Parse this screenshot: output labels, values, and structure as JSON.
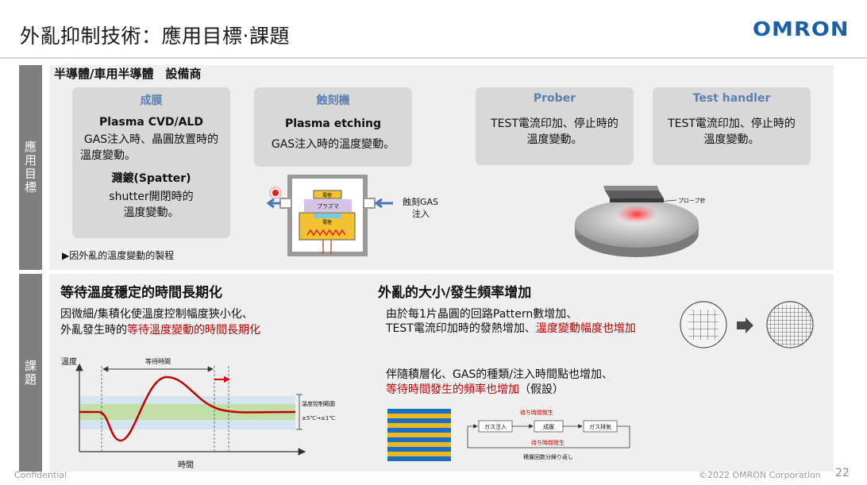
{
  "header": {
    "title": "外亂抑制技術：應用目標‧課題",
    "logo_text": "OMRON"
  },
  "tabs": {
    "application": "應用目標",
    "issue": "課題"
  },
  "application": {
    "heading": "半導體/車用半導體　設備商",
    "boxes": {
      "deposition": {
        "title": "成膜",
        "sub1": "Plasma CVD/ALD",
        "line1": "GAS注入時、晶圓放置時的",
        "line2": "溫度變動。",
        "sub2": "濺鍍(Spatter)",
        "line3": "shutter開閉時的",
        "line4": "溫度變動。"
      },
      "etching": {
        "title": "蝕刻機",
        "sub1": "Plasma etching",
        "line1": "GAS注入時的溫度變動。"
      },
      "prober": {
        "title": "Prober",
        "line1": "TEST電流印加、停止時的",
        "line2": "溫度變動。"
      },
      "handler": {
        "title": "Test handler",
        "line1": "TEST電流印加、停止時的",
        "line2": "溫度變動。"
      }
    },
    "chamber_labels": {
      "top": "電極",
      "plasma": "プラズマ",
      "bottom": "電極",
      "gas": "蝕刻GAS",
      "inject": "注入"
    },
    "probe_label": "プローブ針",
    "note": "▶因外亂的溫度變動的製程"
  },
  "issue": {
    "left_title": "等待溫度穩定的時間長期化",
    "left_line1": "因微細/集積化使溫度控制幅度狹小化、",
    "left_line2_a": "外亂發生時的",
    "left_line2_b": "等待溫度變動的時間長期化",
    "chart_labels": {
      "y": "溫度",
      "x": "時間",
      "wait": "等待時間",
      "range1": "溫度控制範圍",
      "range2": "±5℃→±1℃"
    },
    "right_title": "外亂的大小/發生頻率增加",
    "right_line1": "由於每1片晶圓的回路Pattern數增加、",
    "right_line2_a": "TEST電流印加時的發熱增加、",
    "right_line2_b": "溫度變動幅度也增加",
    "right_line3": "伴隨積層化、GAS的種類/注入時間點也增加、",
    "right_line4_a": "等待時間發生的頻率也增加",
    "right_line4_b": "（假設）",
    "flow": {
      "wait_top": "待ち時間発生",
      "step1": "ガス注入",
      "step2": "成膜",
      "step3": "ガス排気",
      "wait_bottom": "待ち時間発生",
      "repeat": "積層回数分繰り返し"
    }
  },
  "footer": {
    "left": "Confidential",
    "right": "©2022 OMRON Corporation",
    "page": "22"
  },
  "colors": {
    "accent_red": "#c00000",
    "logo_blue": "#1b5fab",
    "box_title_blue": "#5b7fb0",
    "tab_gray": "#7f7f7f"
  }
}
